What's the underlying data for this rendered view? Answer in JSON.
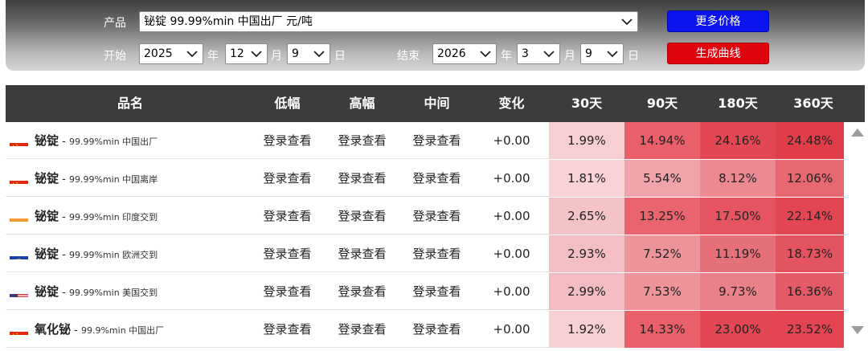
{
  "filters": {
    "product_label": "产品",
    "product_value": "铋锭 99.99%min 中国出厂 元/吨",
    "start_label": "开始",
    "start_year": "2025",
    "start_month": "12",
    "start_day": "9",
    "end_label": "结束",
    "end_year": "2026",
    "end_month": "3",
    "end_day": "9",
    "year_unit": "年",
    "month_unit": "月",
    "day_unit": "日",
    "more_prices_button": "更多价格",
    "generate_curve_button": "生成曲线"
  },
  "table": {
    "headers": [
      "品名",
      "低幅",
      "高幅",
      "中间",
      "变化",
      "30天",
      "90天",
      "180天",
      "360天"
    ],
    "rows": [
      {
        "flag": "cn-flag",
        "name": "铋锭",
        "sep": " - ",
        "spec": "99.99%min 中国出厂",
        "low": "登录查看",
        "high": "登录查看",
        "mid": "登录查看",
        "change": "+0.00",
        "d30": "1.99%",
        "d90": "14.94%",
        "d180": "24.16%",
        "d360": "24.48%",
        "colors": [
          "#f7cfd3",
          "#e9606b",
          "#e34753",
          "#e03d49"
        ]
      },
      {
        "flag": "cn-flag",
        "name": "铋锭",
        "sep": " - ",
        "spec": "99.99%min 中国离岸",
        "low": "登录查看",
        "high": "登录查看",
        "mid": "登录查看",
        "change": "+0.00",
        "d30": "1.81%",
        "d90": "5.54%",
        "d180": "8.12%",
        "d360": "12.06%",
        "colors": [
          "#f8d2d6",
          "#f0a3a9",
          "#eb8a92",
          "#e56873"
        ]
      },
      {
        "flag": "in-flag",
        "name": "铋锭",
        "sep": " - ",
        "spec": "99.99%min 印度交到",
        "low": "登录查看",
        "high": "登录查看",
        "mid": "登录查看",
        "change": "+0.00",
        "d30": "2.65%",
        "d90": "13.25%",
        "d180": "17.50%",
        "d360": "22.14%",
        "colors": [
          "#f4c3c8",
          "#e9646f",
          "#e65462",
          "#e34653"
        ]
      },
      {
        "flag": "eu-flag",
        "name": "铋锭",
        "sep": " - ",
        "spec": "99.99%min 欧洲交到",
        "low": "登录查看",
        "high": "登录查看",
        "mid": "登录查看",
        "change": "+0.00",
        "d30": "2.93%",
        "d90": "7.52%",
        "d180": "11.19%",
        "d360": "18.73%",
        "colors": [
          "#f3bec4",
          "#ed939a",
          "#e6707a",
          "#e35360"
        ]
      },
      {
        "flag": "us-flag",
        "name": "铋锭",
        "sep": " - ",
        "spec": "99.99%min 美国交到",
        "low": "登录查看",
        "high": "登录查看",
        "mid": "登录查看",
        "change": "+0.00",
        "d30": "2.99%",
        "d90": "7.53%",
        "d180": "9.73%",
        "d360": "16.36%",
        "colors": [
          "#f3bcc2",
          "#ed939a",
          "#e9808a",
          "#e45a66"
        ]
      },
      {
        "flag": "cn-flag",
        "name": "氧化铋",
        "sep": " - ",
        "spec": "99.9%min 中国出厂",
        "low": "登录查看",
        "high": "登录查看",
        "mid": "登录查看",
        "change": "+0.00",
        "d30": "1.92%",
        "d90": "14.33%",
        "d180": "23.00%",
        "d360": "23.52%",
        "colors": [
          "#f7d0d4",
          "#e9606b",
          "#e34753",
          "#e34552"
        ]
      }
    ]
  }
}
